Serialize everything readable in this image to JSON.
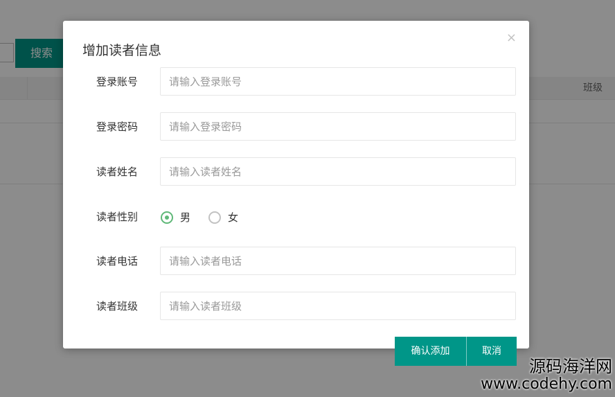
{
  "background": {
    "search_button": "搜索",
    "table_column_class": "班级"
  },
  "dialog": {
    "title": "增加读者信息",
    "close_symbol": "×",
    "fields": [
      {
        "label": "登录账号",
        "placeholder": "请输入登录账号",
        "value": ""
      },
      {
        "label": "登录密码",
        "placeholder": "请输入登录密码",
        "value": ""
      },
      {
        "label": "读者姓名",
        "placeholder": "请输入读者姓名",
        "value": ""
      },
      {
        "label": "读者电话",
        "placeholder": "请输入读者电话",
        "value": ""
      },
      {
        "label": "读者班级",
        "placeholder": "请输入读者班级",
        "value": ""
      }
    ],
    "gender": {
      "label": "读者性别",
      "options": [
        "男",
        "女"
      ],
      "selected": "男"
    },
    "confirm_button": "确认添加",
    "cancel_button": "取消"
  },
  "watermark": {
    "line1": "源码海洋网",
    "line2": "www.codehy.com"
  },
  "colors": {
    "primary": "#009688",
    "radio_checked": "#5fb878"
  }
}
